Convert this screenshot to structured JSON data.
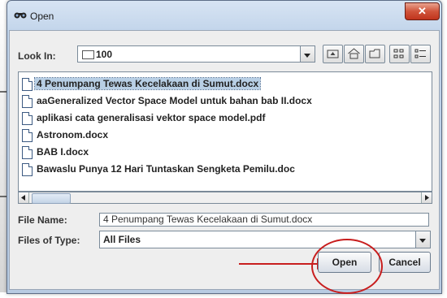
{
  "window": {
    "title": "Open",
    "close_glyph": "✕"
  },
  "look_in": {
    "label": "Look In:",
    "value": "100"
  },
  "toolbar": {
    "icons": [
      "up-one-level-icon",
      "home-icon",
      "new-folder-icon",
      "list-view-icon",
      "details-view-icon"
    ]
  },
  "files": [
    {
      "name": "4 Penumpang Tewas Kecelakaan di Sumut.docx",
      "selected": true
    },
    {
      "name": "aaGeneralized Vector Space Model untuk bahan bab II.docx",
      "selected": false
    },
    {
      "name": "aplikasi cata generalisasi vektor space model.pdf",
      "selected": false
    },
    {
      "name": "Astronom.docx",
      "selected": false
    },
    {
      "name": "BAB I.docx",
      "selected": false
    },
    {
      "name": "Bawaslu Punya 12 Hari Tuntaskan Sengketa Pemilu.doc",
      "selected": false
    }
  ],
  "file_name": {
    "label": "File Name:",
    "value": "4 Penumpang Tewas Kecelakaan di Sumut.docx"
  },
  "files_of_type": {
    "label": "Files of Type:",
    "value": "All Files"
  },
  "buttons": {
    "open": "Open",
    "cancel": "Cancel"
  },
  "annotation_color": "#c81e1e"
}
